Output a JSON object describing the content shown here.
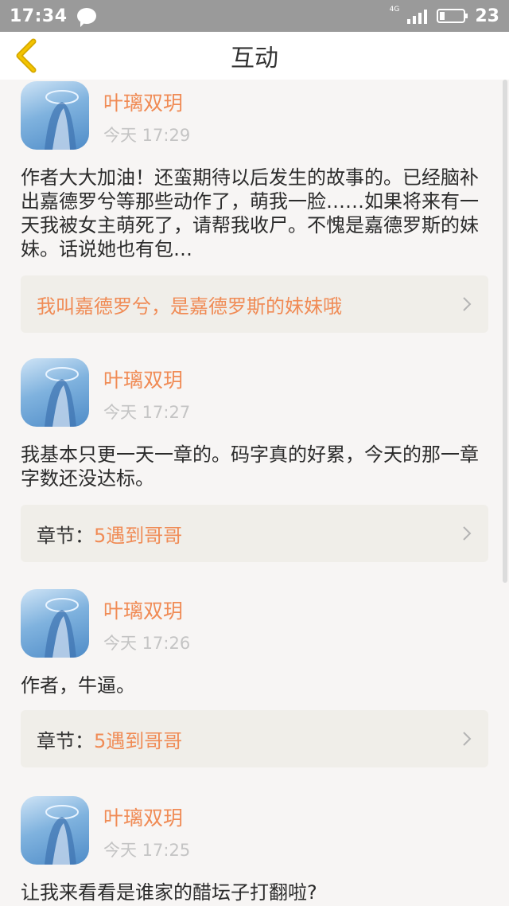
{
  "status_bar": {
    "time": "17:34",
    "network": "4G",
    "battery": "23"
  },
  "header": {
    "title": "互动",
    "back_icon": "chevron-left-icon",
    "accent_color": "#f0b800"
  },
  "comments": [
    {
      "user": "叶璃双玥",
      "time": "今天 17:29",
      "text": "作者大大加油！还蛮期待以后发生的故事的。已经脑补出嘉德罗兮等那些动作了，萌我一脸……如果将来有一天我被女主萌死了，请帮我收尸。不愧是嘉德罗斯的妹妹。话说她也有包…",
      "reply_prefix": "",
      "reply_text": "我叫嘉德罗兮，是嘉德罗斯的妹妹哦"
    },
    {
      "user": "叶璃双玥",
      "time": "今天 17:27",
      "text": "我基本只更一天一章的。码字真的好累，今天的那一章字数还没达标。",
      "reply_prefix": "章节：",
      "reply_text": "5遇到哥哥"
    },
    {
      "user": "叶璃双玥",
      "time": "今天 17:26",
      "text": "作者，牛逼。",
      "reply_prefix": "章节：",
      "reply_text": "5遇到哥哥"
    },
    {
      "user": "叶璃双玥",
      "time": "今天 17:25",
      "text": "让我来看看是谁家的醋坛子打翻啦?"
    }
  ],
  "colors": {
    "name": "#f08b55",
    "time": "#c4c4c4",
    "reply_bg": "#f0eee9",
    "status_bar": "#9a9a9a"
  }
}
